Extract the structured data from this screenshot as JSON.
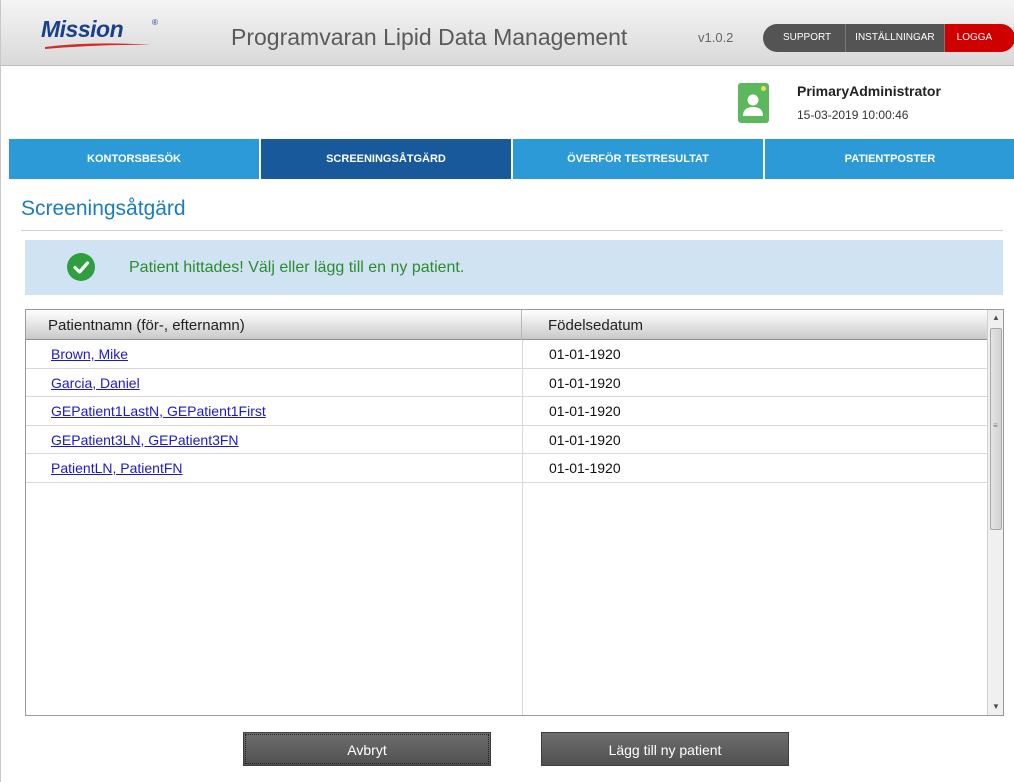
{
  "header": {
    "logo_text": "Mission",
    "logo_mark": "®",
    "app_title": "Programvaran Lipid Data Management",
    "version": "v1.0.2",
    "support_label": "SUPPORT",
    "settings_label": "INSTÄLLNINGAR",
    "logout_label": "LOGGA UT",
    "brand_color": "#1b3f8f",
    "logout_color": "#d10000"
  },
  "user": {
    "name": "PrimaryAdministrator",
    "datetime": "15-03-2019 10:00:46",
    "avatar_icon": "user-avatar-icon"
  },
  "nav": {
    "tabs": [
      {
        "label": "KONTORSBESÖK",
        "active": false
      },
      {
        "label": "SCREENINGSÅTGÄRD",
        "active": true
      },
      {
        "label": "ÖVERFÖR TESTRESULTAT",
        "active": false
      },
      {
        "label": "PATIENTPOSTER",
        "active": false
      }
    ],
    "tab_color": "#2b9ad6",
    "active_tab_color": "#17599a"
  },
  "page": {
    "title": "Screeningsåtgärd"
  },
  "alert": {
    "icon": "check-circle-icon",
    "message": "Patient hittades! Välj eller lägg till en ny patient.",
    "background": "#cfe3f3",
    "text_color": "#2c8c2c"
  },
  "table": {
    "columns": [
      "Patientnamn (för-, efternamn)",
      "Födelsedatum"
    ],
    "rows": [
      {
        "name": "Brown, Mike",
        "dob": "01-01-1920"
      },
      {
        "name": "Garcia, Daniel",
        "dob": "01-01-1920"
      },
      {
        "name": "GEPatient1LastN, GEPatient1First",
        "dob": "01-01-1920"
      },
      {
        "name": "GEPatient3LN, GEPatient3FN",
        "dob": "01-01-1920"
      },
      {
        "name": "PatientLN, PatientFN",
        "dob": "01-01-1920"
      }
    ]
  },
  "buttons": {
    "cancel_label": "Avbryt",
    "add_label": "Lägg till ny patient"
  }
}
